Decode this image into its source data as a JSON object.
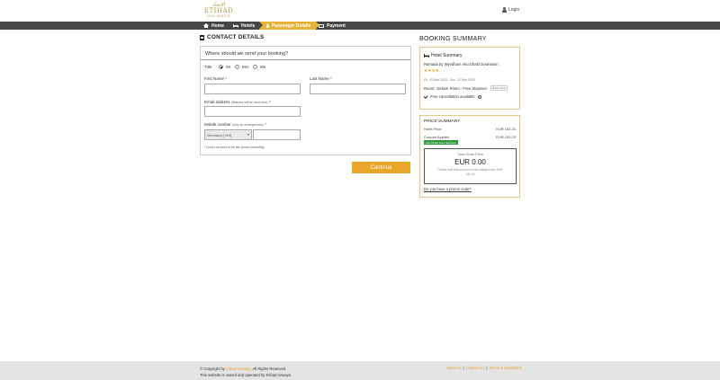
{
  "header": {
    "logo_arabic": "الاتحاد",
    "logo_brand": "ETIHAD",
    "logo_sub": "HOLIDAYS",
    "login_label": "Login"
  },
  "nav": {
    "steps": [
      {
        "label": "Home",
        "icon": "home-icon"
      },
      {
        "label": "Hotels",
        "icon": "bed-icon"
      },
      {
        "label": "Passenger Details",
        "icon": "person-icon",
        "active": true
      },
      {
        "label": "Payment",
        "icon": "card-icon"
      }
    ]
  },
  "contact": {
    "section_title": "CONTACT DETAILS",
    "card_heading": "Where should we send your booking?",
    "title_label": "Title",
    "title_options": [
      "Mr",
      "Mrs",
      "Ms"
    ],
    "title_selected": "Mr",
    "first_name_label": "First Name",
    "last_name_label": "Last Name",
    "email_label": "Email address",
    "email_hint": "(itinerary will be sent here)",
    "mobile_label": "Mobile number",
    "mobile_hint": "(only for emergencies)",
    "country_value": "Germany (+49)",
    "required_mark": "*",
    "fineprint": "Does not need to be the person travelling.",
    "continue_label": "Continue"
  },
  "booking_summary": {
    "title": "BOOKING SUMMARY",
    "hotel_summary_label": "Hotel Summary",
    "hotel_name": "Ramada by Wyndham Abu Dhabi Downtown",
    "stars": "★★★★",
    "star_count": 4,
    "dates": "Fri, 20 Mar 2020 - Sun, 22 Mar 2020",
    "room_label": "Room:",
    "room_value": "Deluxe Room - Free Stopover",
    "room_tag": "Room Only",
    "cancellation": "Free cancellation available",
    "info_glyph": "i"
  },
  "price_summary": {
    "title": "PRICE SUMMARY",
    "hotel_price_label": "Hotel Price",
    "hotel_price_value": "EUR 152.23",
    "coupon_label": "Coupon Applied",
    "coupon_value": "EUR 152.23",
    "coupon_badge": "Abu Dhabi Free Stopover",
    "total_label": "Total Hotel Price",
    "total_value": "EUR 0.00",
    "total_note": "Please note that your price has changed from EUR 152.23",
    "promo_link": "Do you have a promo code?"
  },
  "footer": {
    "copyright_prefix": "© Copyright by",
    "copyright_link": "Etihad Airways",
    "copyright_suffix": ". All Rights Reserved.",
    "operated": "This website is owned and operated by Etihad Airways.",
    "links": [
      "About us",
      "Contact Us",
      "Terms & Conditions"
    ],
    "separator": "|"
  },
  "colors": {
    "accent": "#e8a62a",
    "nav_bg": "#464646",
    "coupon_green": "#2e9a3a"
  }
}
